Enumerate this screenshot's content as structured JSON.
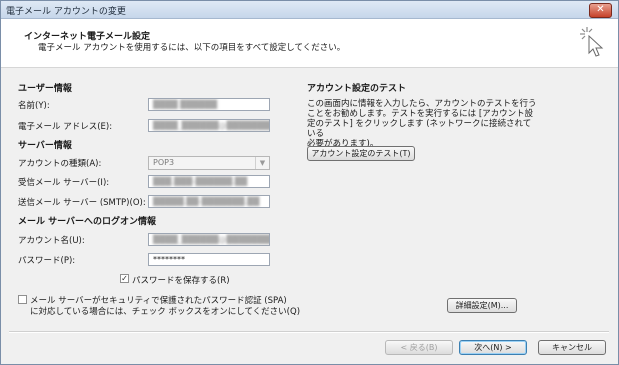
{
  "window": {
    "title": "電子メール アカウントの変更",
    "close": "✕"
  },
  "header": {
    "title": "インターネット電子メール設定",
    "subtitle": "電子メール アカウントを使用するには、以下の項目をすべて設定してください。"
  },
  "user_info": {
    "section": "ユーザー情報",
    "name_label": "名前(Y):",
    "name_value": "████ ██████",
    "email_label": "電子メール アドレス(E):",
    "email_value": "████_██████@████████.██.██"
  },
  "server_info": {
    "section": "サーバー情報",
    "account_type_label": "アカウントの種類(A):",
    "account_type_value": "POP3",
    "incoming_label": "受信メール サーバー(I):",
    "incoming_value": "███.███-██████.██",
    "outgoing_label": "送信メール サーバー (SMTP)(O):",
    "outgoing_value": "█████.██-███████.██"
  },
  "logon_info": {
    "section": "メール サーバーへのログオン情報",
    "account_name_label": "アカウント名(U):",
    "account_name_value": "████_██████@████████.██.██",
    "password_label": "パスワード(P):",
    "password_value": "********",
    "save_password_label": "パスワードを保存する(R)",
    "save_password_checked": "✓",
    "spa_label_line1": "メール サーバーがセキュリティで保護されたパスワード認証 (SPA)",
    "spa_label_line2": "に対応している場合には、チェック ボックスをオンにしてください(Q)"
  },
  "test": {
    "section": "アカウント設定のテスト",
    "para_line1": "この画面内に情報を入力したら、アカウントのテストを行う",
    "para_line2": "ことをお勧めします。テストを実行するには [アカウント設",
    "para_line3": "定のテスト] をクリックします (ネットワークに接続されている",
    "para_line4": "必要があります)。",
    "test_button": "アカウント設定のテスト(T)"
  },
  "buttons": {
    "more_settings": "詳細設定(M)...",
    "back": "< 戻る(B)",
    "next": "次へ(N) >",
    "cancel": "キャンセル"
  }
}
